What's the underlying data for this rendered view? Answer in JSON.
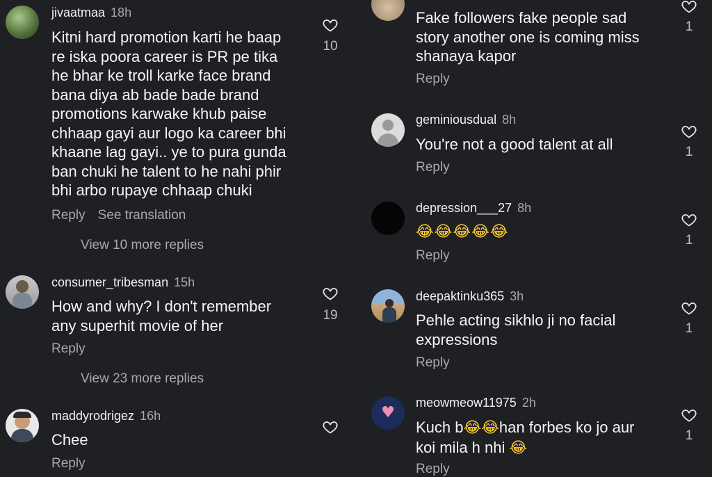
{
  "comments_left": [
    {
      "username": "jivaatmaa",
      "time": "18h",
      "lines": [
        "Kitni hard promotion karti he baap",
        "re iska poora career is PR pe tika",
        "he bhar ke troll karke face brand",
        "bana diya ab bade bade brand",
        "promotions karwake khub paise",
        "chhaap gayi aur logo ka career bhi",
        "khaane lag gayi.. ye to pura gunda",
        "ban chuki he talent to he nahi phir",
        "bhi arbo rupaye chhaap chuki"
      ],
      "reply": "Reply",
      "translate": "See translation",
      "more_replies": "View 10 more replies",
      "likes": "10"
    },
    {
      "username": "consumer_tribesman",
      "time": "15h",
      "lines": [
        "How and why? I don't remember",
        "any superhit movie of her"
      ],
      "reply": "Reply",
      "more_replies": "View 23 more replies",
      "likes": "19"
    },
    {
      "username": "maddyrodrigez",
      "time": "16h",
      "lines": [
        "Chee"
      ],
      "reply": "Reply",
      "likes": ""
    }
  ],
  "comments_right": [
    {
      "lines": [
        "Fake followers fake people sad",
        "story another one is coming miss",
        "shanaya kapor"
      ],
      "reply": "Reply",
      "likes": "1"
    },
    {
      "username": "geminiousdual",
      "time": "8h",
      "lines": [
        "You're not a good talent at all"
      ],
      "reply": "Reply",
      "likes": "1"
    },
    {
      "username": "depression___27",
      "time": "8h",
      "emoji": "😂😂😂😂😂",
      "reply": "Reply",
      "likes": "1"
    },
    {
      "username": "deepaktinku365",
      "time": "3h",
      "lines": [
        "Pehle acting sikhlo ji no facial",
        "expressions"
      ],
      "reply": "Reply",
      "likes": "1"
    },
    {
      "username": "meowmeow11975",
      "time": "2h",
      "line1_a": "Kuch b",
      "line1_emoji": "😂😂",
      "line1_b": "han forbes ko jo aur",
      "line2_a": "koi mila h nhi",
      "line2_emoji": "😂",
      "reply": "Reply",
      "likes": "1"
    }
  ],
  "colors": {
    "background": "#1f2024",
    "text": "#f5f5f5",
    "muted": "#a8a8a8"
  },
  "icons": {
    "like": "heart-outline-icon"
  }
}
